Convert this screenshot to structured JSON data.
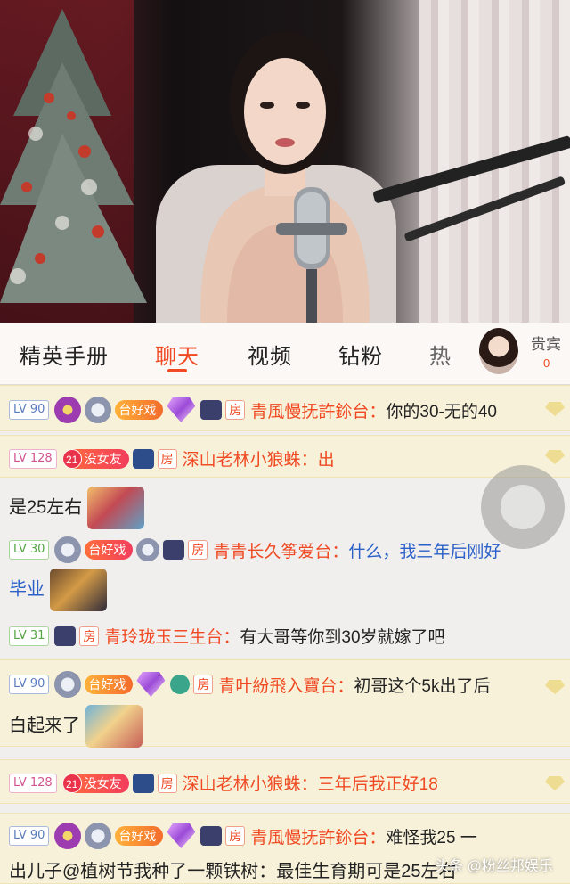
{
  "tabs": [
    "精英手册",
    "聊天",
    "视频",
    "钻粉",
    "热"
  ],
  "active_tab": "聊天",
  "guest": {
    "title": "贵宾",
    "count": "0"
  },
  "messages": [
    {
      "level": "LV 90",
      "badge_text": "台好戏",
      "room": "房",
      "name": "青風慢抚許鉩台：",
      "text": "你的30-无的40"
    },
    {
      "level": "LV 128",
      "fan_num": "21",
      "fan_text": "没女友",
      "room": "房",
      "name": "深山老林小狼蛛：",
      "text": "出"
    },
    {
      "wrap": "是25左右"
    },
    {
      "level": "LV 30",
      "fan_text": "台好戏",
      "room": "房",
      "name": "青青长久筝爱台：",
      "text": "什么，我三年后刚好"
    },
    {
      "wrap": "毕业"
    },
    {
      "level": "LV 31",
      "room": "房",
      "name": "青玲珑玉三生台：",
      "text": "有大哥等你到30岁就嫁了吧"
    },
    {
      "level": "LV 90",
      "fan_text": "台好戏",
      "room": "房",
      "name": "青叶紛飛入寶台：",
      "text": "初哥这个5k出了后"
    },
    {
      "wrap": "白起来了"
    },
    {
      "level": "LV 128",
      "fan_num": "21",
      "fan_text": "没女友",
      "room": "房",
      "name": "深山老林小狼蛛：",
      "text": "三年后我正好18"
    },
    {
      "level": "LV 90",
      "badge_text": "台好戏",
      "room": "房",
      "name": "青風慢抚許鉩台：",
      "text": "难怪我25 一"
    },
    {
      "wrap": "出儿子@植树节我种了一颗铁树：最佳生育期可是25左右"
    }
  ],
  "watermark": "头条 @粉丝邦娱乐",
  "colors": {
    "accent": "#ef4a23",
    "gold_row": "#f8f1d9",
    "blue_text": "#2a60c8"
  }
}
